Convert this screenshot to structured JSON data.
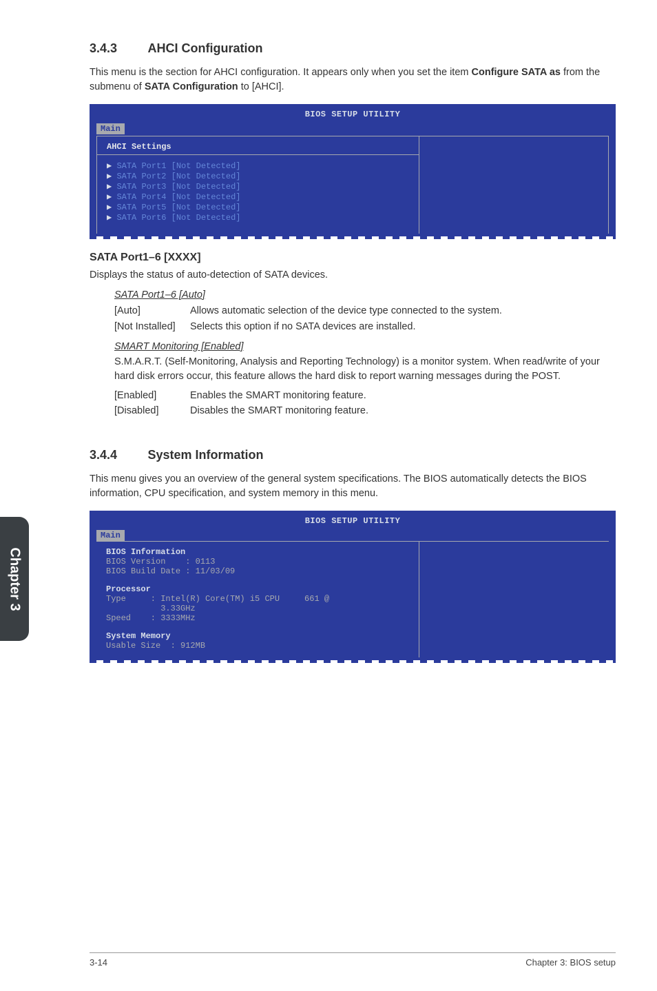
{
  "section343": {
    "num": "3.4.3",
    "title": "AHCI Configuration",
    "intro_a": "This menu is the section for AHCI configuration. It appears only when you set the item ",
    "intro_b": "Configure SATA as",
    "intro_c": " from the submenu of ",
    "intro_d": "SATA Configuration",
    "intro_e": " to [AHCI]."
  },
  "bios1": {
    "util": "BIOS SETUP UTILITY",
    "tab": "Main",
    "heading": "AHCI Settings",
    "lines": [
      "SATA Port1 [Not Detected]",
      "SATA Port2 [Not Detected]",
      "SATA Port3 [Not Detected]",
      "SATA Port4 [Not Detected]",
      "SATA Port5 [Not Detected]",
      "SATA Port6 [Not Detected]"
    ]
  },
  "sata": {
    "heading": "SATA Port1–6 [XXXX]",
    "desc": "Displays the status of auto-detection of SATA devices.",
    "sub1": "SATA Port1–6 [Auto]",
    "row1_k": "[Auto]",
    "row1_v": "Allows automatic selection of the device type connected to the system.",
    "row2_k": "[Not Installed]",
    "row2_v": "Selects this option if no SATA devices are installed.",
    "sub2": "SMART Monitoring [Enabled]",
    "smart_desc": "S.M.A.R.T. (Self-Monitoring, Analysis and Reporting Technology) is a monitor system. When read/write of your hard disk errors occur, this feature allows the hard disk to report warning messages during the POST.",
    "row3_k": "[Enabled]",
    "row3_v": "Enables the SMART monitoring feature.",
    "row4_k": "[Disabled]",
    "row4_v": "Disables the SMART monitoring feature."
  },
  "section344": {
    "num": "3.4.4",
    "title": "System Information",
    "intro": "This menu gives you an overview of the general system specifications. The BIOS automatically detects the BIOS information, CPU specification, and system memory in this menu."
  },
  "bios2": {
    "util": "BIOS SETUP UTILITY",
    "tab": "Main",
    "l1": "BIOS Information",
    "l2": "BIOS Version    : 0113",
    "l3": "BIOS Build Date : 11/03/09",
    "l4": "Processor",
    "l5": "Type     : Intel(R) Core(TM) i5 CPU     661 @",
    "l6": "           3.33GHz",
    "l7": "Speed    : 3333MHz",
    "l8": "System Memory",
    "l9": "Usable Size  : 912MB"
  },
  "chapter": "Chapter 3",
  "footer_left": "3-14",
  "footer_right": "Chapter 3: BIOS setup"
}
